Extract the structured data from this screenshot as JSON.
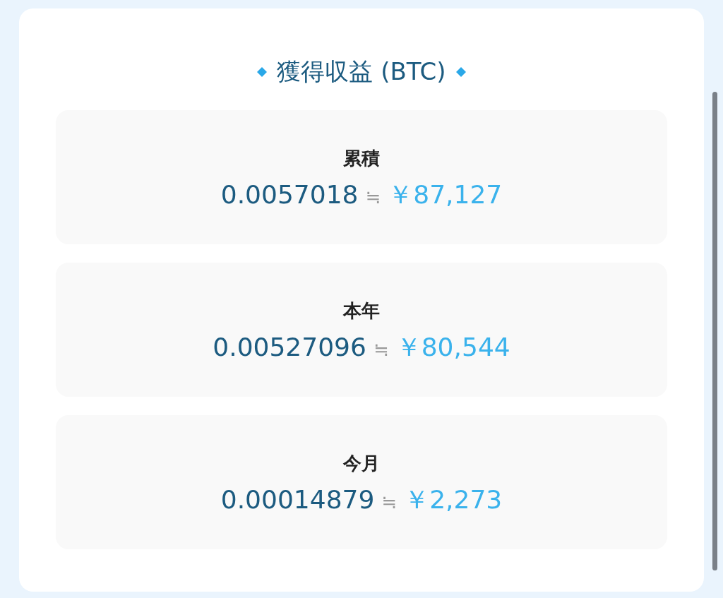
{
  "title": "獲得収益 (BTC)",
  "stats": [
    {
      "label": "累積",
      "btc": "0.0057018",
      "approx": "≒",
      "yen": "￥87,127"
    },
    {
      "label": "本年",
      "btc": "0.00527096",
      "approx": "≒",
      "yen": "￥80,544"
    },
    {
      "label": "今月",
      "btc": "0.00014879",
      "approx": "≒",
      "yen": "￥2,273"
    }
  ]
}
